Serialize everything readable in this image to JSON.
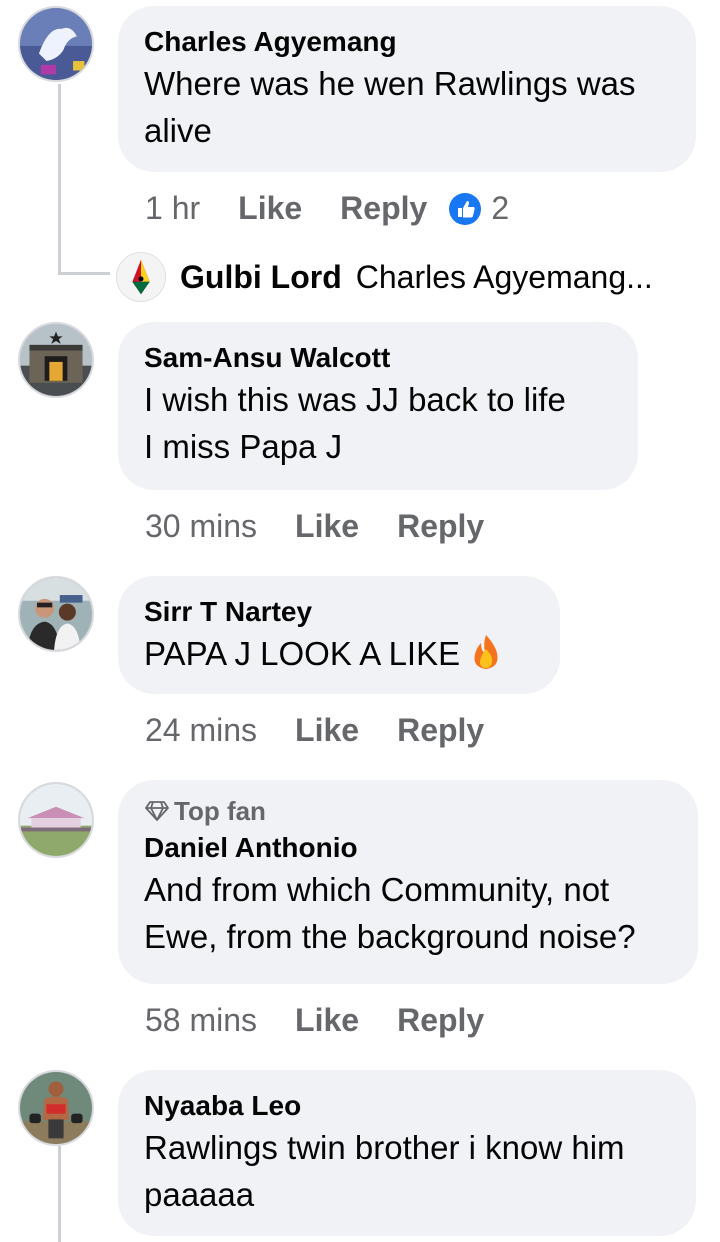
{
  "comments": [
    {
      "name": "Charles Agyemang",
      "text": "Where was he wen Rawlings was\nalive",
      "time": "1 hr",
      "like": "Like",
      "reply": "Reply",
      "reactions": "2"
    },
    {
      "name": "Sam-Ansu Walcott",
      "text": "I wish this was JJ back to life\nI miss Papa J",
      "time": "30 mins",
      "like": "Like",
      "reply": "Reply"
    },
    {
      "name": "Sirr T Nartey",
      "text": "PAPA J LOOK A LIKE",
      "time": "24 mins",
      "like": "Like",
      "reply": "Reply"
    },
    {
      "badge": "Top fan",
      "name": "Daniel Anthonio",
      "text": "And from which Community,  not\nEwe, from the background noise?",
      "time": "58 mins",
      "like": "Like",
      "reply": "Reply"
    },
    {
      "name": "Nyaaba Leo",
      "text": "Rawlings twin brother i know him\npaaaaa"
    }
  ],
  "reply_preview": {
    "name": "Gulbi Lord",
    "text": "Charles Agyemang..."
  },
  "colors": {
    "bubble": "#f0f2f5",
    "meta": "#65676b",
    "like_blue": "#1877f2"
  }
}
